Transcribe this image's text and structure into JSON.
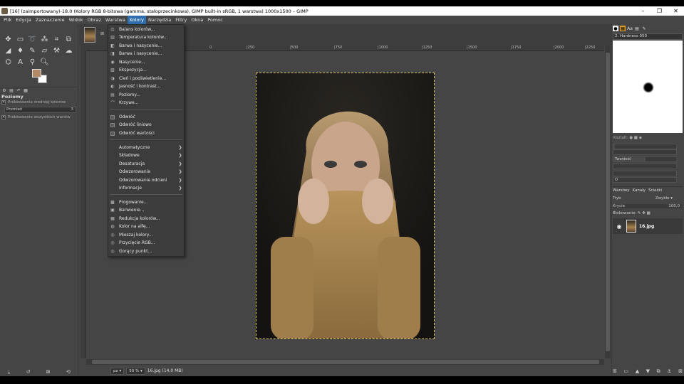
{
  "window": {
    "title": "[16] (zaimportowany)-18.0 (Kolory RGB 8-bitowa (gamma, stałoprzecinkowa), GIMP built-in sRGB, 1 warstwa) 1000x1500 – GIMP",
    "minimize": "–",
    "maximize": "❐",
    "close": "✕"
  },
  "menubar": [
    "Plik",
    "Edycja",
    "Zaznaczenie",
    "Widok",
    "Obraz",
    "Warstwa",
    "Kolory",
    "Narzędzia",
    "Filtry",
    "Okna",
    "Pomoc"
  ],
  "menubar_active": "Kolory",
  "colors_menu": {
    "group1": [
      "Balans kolorów...",
      "Temperatura kolorów...",
      "Barwa i nasycenie...",
      "Barwa i nasycenie...",
      "Nasycenie...",
      "Ekspozycja...",
      "Cień i podświetlenie...",
      "Jasność i kontrast...",
      "Poziomy...",
      "Krzywe..."
    ],
    "group2": [
      "Odwróć",
      "Odwróć liniowo",
      "Odwróć wartości"
    ],
    "group3": [
      "Automatyczne",
      "Składowe",
      "Desaturacja",
      "Odwzorowania",
      "Odwzorowanie odcieni",
      "Informacje"
    ],
    "group4": [
      "Progowanie...",
      "Barwienie...",
      "Redukcja kolorów...",
      "Kolor na alfę...",
      "Mieszaj kolory...",
      "Przycięcie RGB...",
      "Gorący punkt..."
    ]
  },
  "toolbox": {
    "fg_color": "#b08a66",
    "bg_color": "#ffffff",
    "options_title": "Poziomy",
    "opt_sample_avg": "Próbkowanie średniej kolorów",
    "opt_radius": "Promień",
    "opt_radius_value": "3",
    "opt_sample_merged": "Próbkowanie wszystkich warstw"
  },
  "rulers": {
    "h_labels": [
      "0",
      "|250",
      "|500",
      "|750",
      "|1000",
      "|1250",
      "|1500",
      "|1750",
      "|2000",
      "|2250"
    ]
  },
  "statusbar": {
    "unit": "px",
    "zoom": "50 %",
    "info": "16.jpg (14,0 MB)"
  },
  "brushes": {
    "name": "2. Hardness 050",
    "shape_label": "Kształt:",
    "hardness_label": "Twardość",
    "spacing_label": "O"
  },
  "layers": {
    "tabs": [
      "Warstwy",
      "Kanały",
      "Ścieżki"
    ],
    "mode_label": "Tryb",
    "mode_value": "Zwykłe",
    "opacity_label": "Krycie",
    "opacity_value": "100,0",
    "lock_label": "Blokowanie:",
    "layer_name": "16.jpg"
  }
}
